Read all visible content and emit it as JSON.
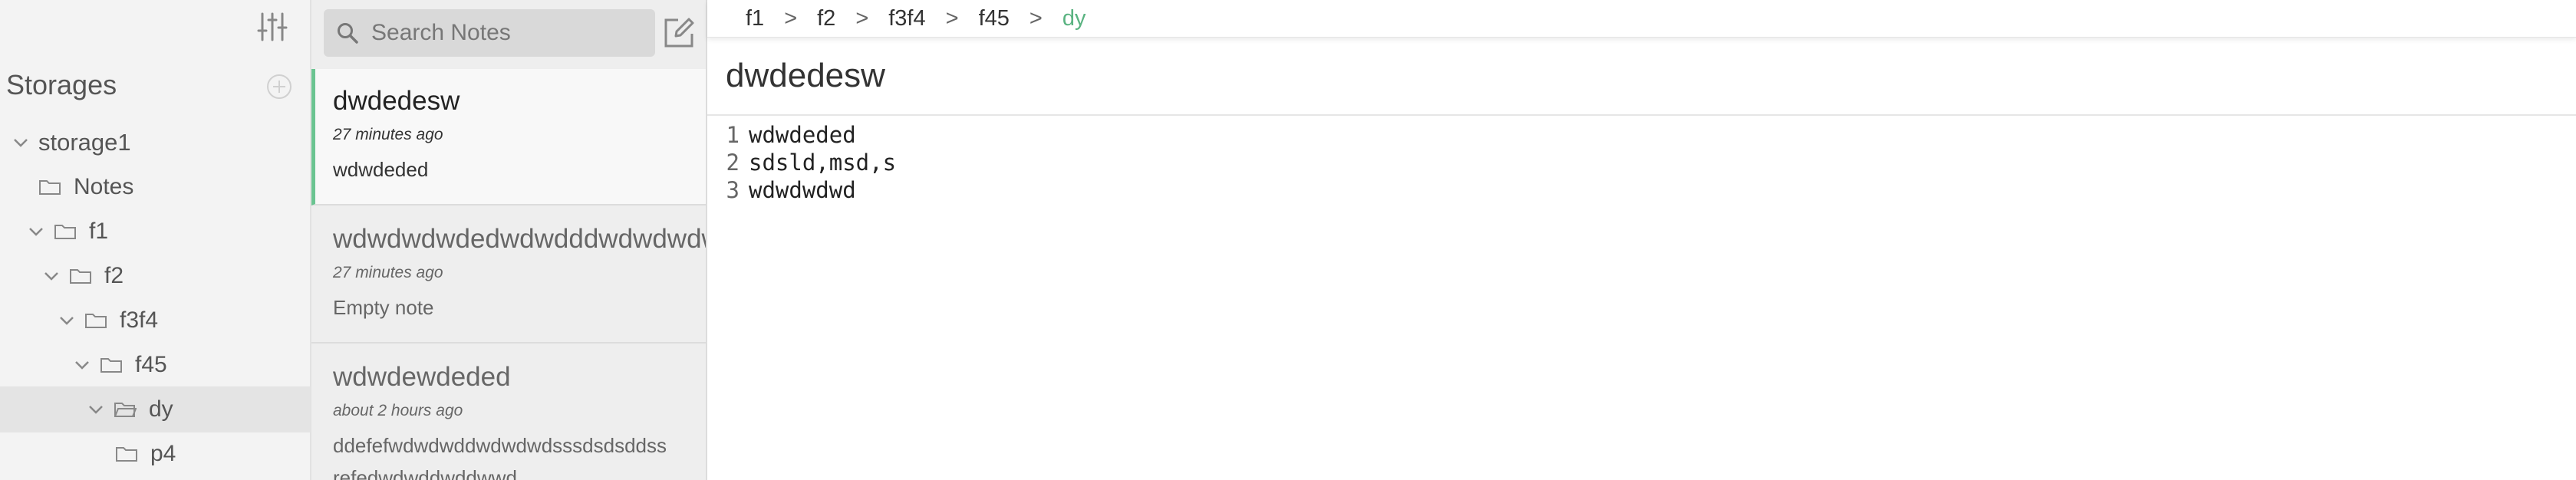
{
  "sidebar": {
    "storages_title": "Storages",
    "tree": [
      {
        "label": "storage1",
        "kind": "storage",
        "expanded": true
      },
      {
        "label": "Notes",
        "kind": "folder"
      },
      {
        "label": "f1",
        "kind": "folder",
        "expanded": true
      },
      {
        "label": "f2",
        "kind": "folder",
        "expanded": true
      },
      {
        "label": "f3f4",
        "kind": "folder",
        "expanded": true
      },
      {
        "label": "f45",
        "kind": "folder",
        "expanded": true
      },
      {
        "label": "dy",
        "kind": "folder",
        "expanded": true,
        "active": true,
        "open_folder": true
      },
      {
        "label": "p4",
        "kind": "folder"
      }
    ]
  },
  "notelist": {
    "search_placeholder": "Search Notes",
    "notes": [
      {
        "title": "dwdedesw",
        "time": "27 minutes ago",
        "preview": "wdwdeded",
        "selected": true
      },
      {
        "title": "wdwdwdwdedwdwdddwdwdwdw",
        "time": "27 minutes ago",
        "preview": "Empty note"
      },
      {
        "title": "wdwdewdeded",
        "time": "about 2 hours ago",
        "preview": "ddefefwdwdwddwdwdwdsssdsdsddss",
        "preview2": "refedwdwddwddwwd"
      }
    ]
  },
  "editor": {
    "breadcrumb": [
      "f1",
      "f2",
      "f3f4",
      "f45",
      "dy"
    ],
    "breadcrumb_separator": ">",
    "title": "dwdedesw",
    "lines": [
      "wdwdeded",
      "sdsld,msd,s",
      "wdwdwdwd"
    ]
  },
  "colors": {
    "accent": "#5ab381",
    "selected_border": "#6ac491",
    "sidebar_bg": "#f3f3f3",
    "notelist_bg": "#eeeeee"
  }
}
